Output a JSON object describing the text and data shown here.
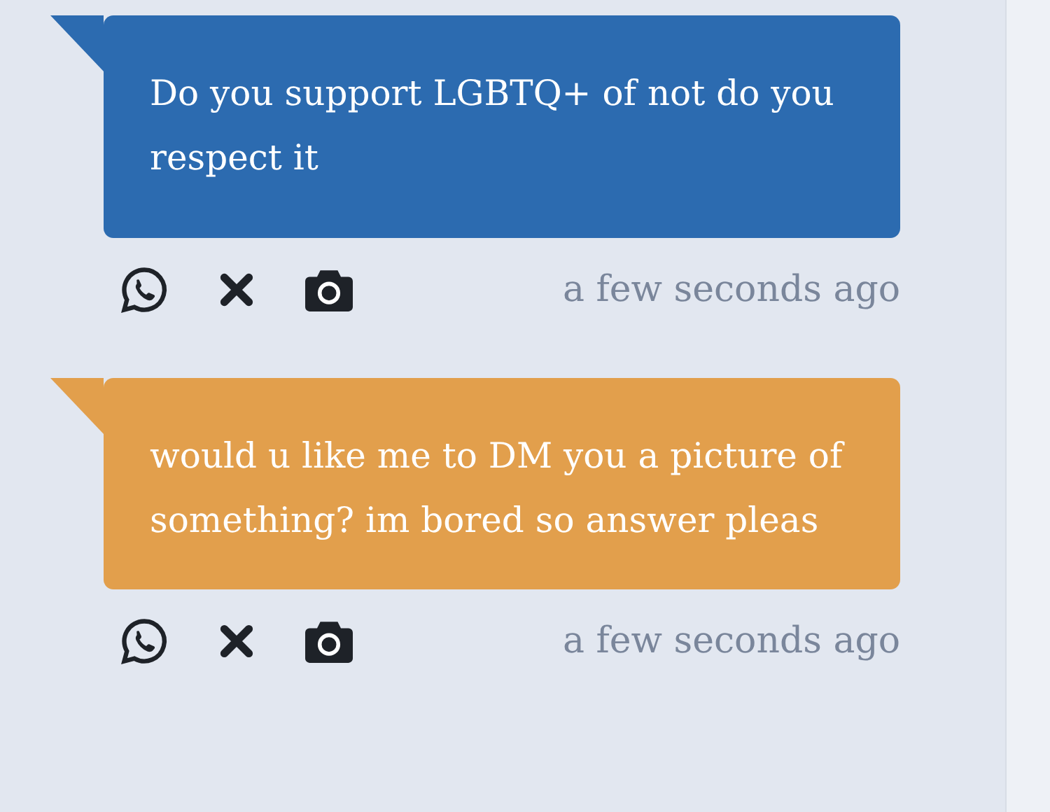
{
  "messages": [
    {
      "text": "Do you support LGBTQ+ of not do you respect it",
      "color": "#2c6bb0",
      "time": "a few seconds ago"
    },
    {
      "text": "would u like me to DM you a picture of something? im bored so answer pleas",
      "color": "#e29f4c",
      "time": "a few seconds ago"
    }
  ]
}
